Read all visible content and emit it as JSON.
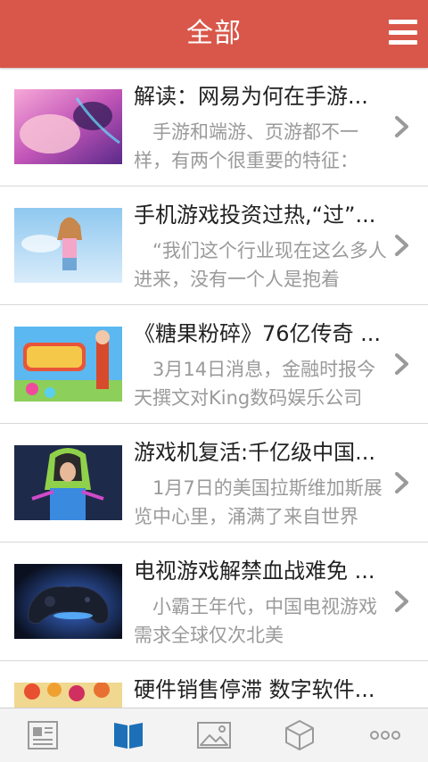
{
  "header": {
    "title": "全部"
  },
  "icons": {
    "menu": "hamburger-menu-icon",
    "chevron": "chevron-right-icon",
    "tabs": [
      "news-icon",
      "book-icon",
      "image-icon",
      "cube-icon",
      "more-icon"
    ]
  },
  "colors": {
    "header_bg": "#d9574a",
    "active_tab": "#1d6fb8",
    "inactive_tab": "#9a9a9a"
  },
  "articles": [
    {
      "title": "解读：网易为何在手游...",
      "summary": "手游和端游、页游都不一样，有两个很重要的特征："
    },
    {
      "title": "手机游戏投资过热,“过”...",
      "summary": "“我们这个行业现在这么多人进来，没有一个人是抱着"
    },
    {
      "title": "《糖果粉碎》76亿传奇 ...",
      "summary": "3月14日消息，金融时报今天撰文对King数码娱乐公司"
    },
    {
      "title": "游戏机复活:千亿级中国...",
      "summary": "1月7日的美国拉斯维加斯展览中心里，涌满了来自世界"
    },
    {
      "title": "电视游戏解禁血战难免 ...",
      "summary": "小霸王年代，中国电视游戏需求全球仅次北美"
    },
    {
      "title": "硬件销售停滞 数字软件...",
      "summary": ""
    }
  ],
  "tabbar": {
    "active_index": 1
  }
}
